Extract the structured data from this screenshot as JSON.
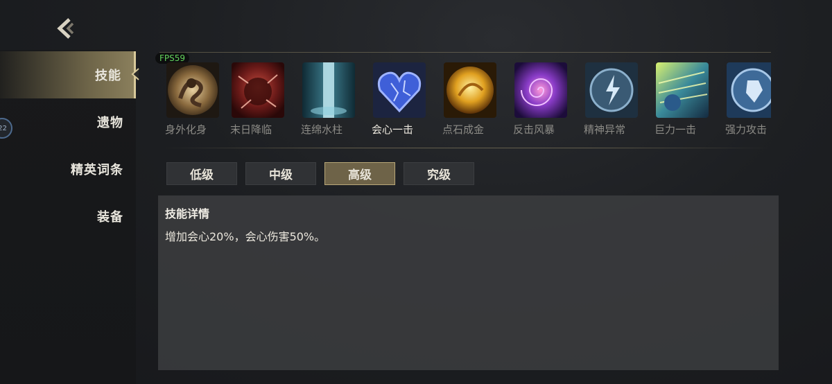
{
  "fps_label": "FPS59",
  "sidebar": {
    "items": [
      {
        "label": "技能",
        "active": true
      },
      {
        "label": "遗物",
        "active": false
      },
      {
        "label": "精英词条",
        "active": false
      },
      {
        "label": "装备",
        "active": false
      }
    ],
    "badge": "22"
  },
  "skills": [
    {
      "label": "身外化身",
      "icon": "shadow-clone-icon"
    },
    {
      "label": "末日降临",
      "icon": "doom-icon"
    },
    {
      "label": "连绵水柱",
      "icon": "water-pillar-icon"
    },
    {
      "label": "会心一击",
      "icon": "crystal-heart-icon",
      "selected": true
    },
    {
      "label": "点石成金",
      "icon": "golden-orb-icon"
    },
    {
      "label": "反击风暴",
      "icon": "vortex-icon"
    },
    {
      "label": "精神异常",
      "icon": "lightning-rune-icon"
    },
    {
      "label": "巨力一击",
      "icon": "power-strike-icon"
    },
    {
      "label": "强力攻击",
      "icon": "strong-attack-icon"
    }
  ],
  "tiers": [
    {
      "label": "低级",
      "active": false
    },
    {
      "label": "中级",
      "active": false
    },
    {
      "label": "高级",
      "active": true
    },
    {
      "label": "究级",
      "active": false
    }
  ],
  "detail": {
    "title": "技能详情",
    "text": "增加会心20%，会心伤害50%。"
  },
  "colors": {
    "accent": "#6e6348",
    "accent_border": "#b9a878",
    "fps": "#63d25c"
  }
}
